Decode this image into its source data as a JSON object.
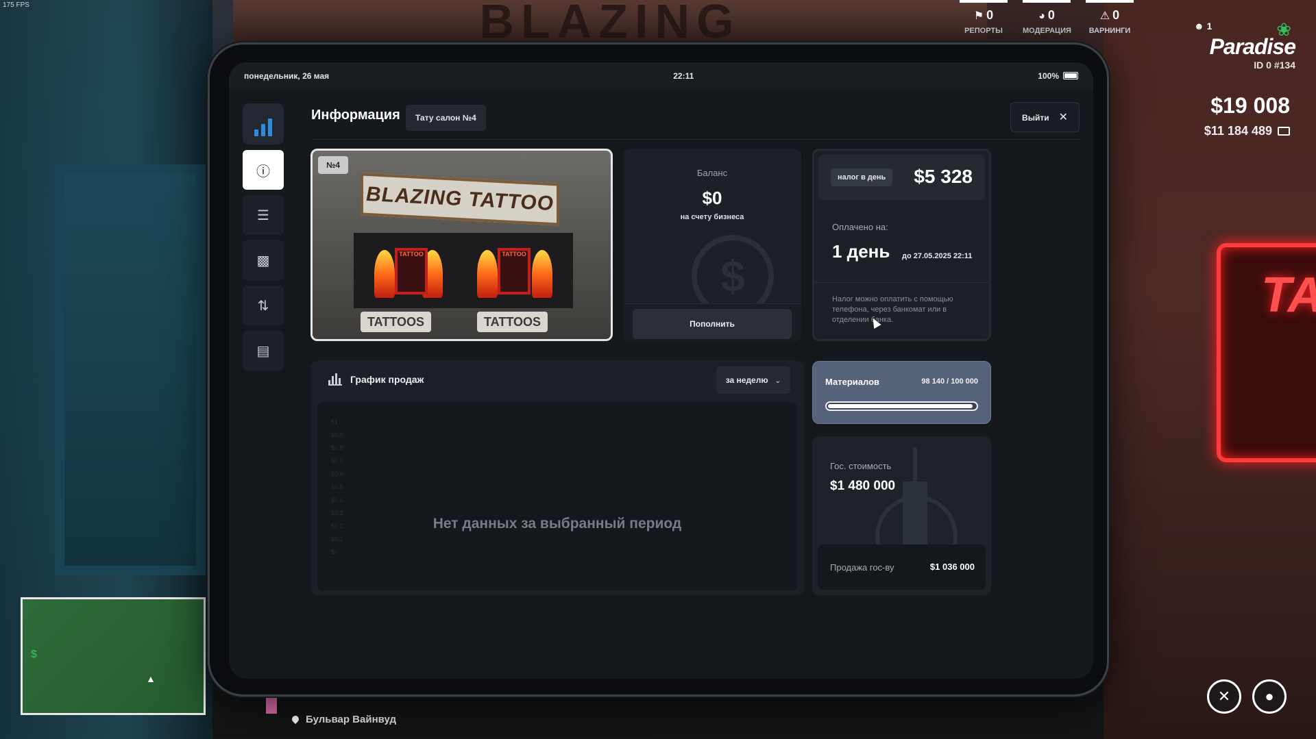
{
  "game": {
    "fps": "175 FPS",
    "world_sign": "BLAZING",
    "neon_text": "TA"
  },
  "hud": {
    "stats": [
      {
        "icon": "reports-icon",
        "value": "0",
        "label": "РЕПОРТЫ"
      },
      {
        "icon": "moderation-icon",
        "value": "0",
        "label": "МОДЕРАЦИЯ"
      },
      {
        "icon": "warning-icon",
        "value": "0",
        "label": "ВАРНИНГИ"
      }
    ],
    "logo": {
      "online": "1",
      "title": "Paradise",
      "ids": "ID 0 #134"
    },
    "cash": "$19 008",
    "bank": "$11 184 489",
    "location": "Бульвар Вайнвуд",
    "round_buttons": [
      "tools-icon",
      "drop-icon"
    ]
  },
  "tablet": {
    "status": {
      "date": "понедельник, 26 мая",
      "time": "22:11",
      "battery": "100%"
    },
    "header": {
      "title": "Информация",
      "business": "Тату салон №4",
      "exit": "Выйти"
    },
    "sidebar": [
      {
        "icon": "info-icon",
        "active": true
      },
      {
        "icon": "layers-icon",
        "active": false
      },
      {
        "icon": "bar-chart-icon",
        "active": false
      },
      {
        "icon": "money-transfer-icon",
        "active": false
      },
      {
        "icon": "clipboard-icon",
        "active": false
      }
    ],
    "photo": {
      "badge": "№4",
      "sign": "BLAZING TATTOO",
      "window_left": "TATTOO",
      "window_right": "TATTOO",
      "sign_left": "TATTOOS",
      "sign_right": "TATTOOS"
    },
    "balance": {
      "label": "Баланс",
      "value": "$0",
      "sub": "на счету бизнеса",
      "button": "Пополнить"
    },
    "tax": {
      "chip": "налог в день",
      "amount": "$5 328",
      "paid_label": "Оплачено на:",
      "paid_value": "1 день",
      "paid_until": "до 27.05.2025 22:11",
      "note": "Налог можно оплатить с помощью телефона, через банкомат или в отделении банка."
    },
    "chart": {
      "title": "График продаж",
      "period": "за неделю",
      "no_data": "Нет данных за выбранный период",
      "y_ticks": [
        "$1",
        "$0.9",
        "$0.8",
        "$0.7",
        "$0.6",
        "$0.5",
        "$0.4",
        "$0.3",
        "$0.2",
        "$0.1",
        "$0"
      ],
      "x_ticks": [
        "",
        "",
        "",
        "",
        "",
        "",
        ""
      ],
      "legend": [
        {
          "name": "",
          "color": "#1f2329"
        },
        {
          "name": "",
          "color": "#2a2f36"
        }
      ]
    },
    "materials": {
      "label": "Материалов",
      "count": "98 140 / 100 000",
      "fraction": 0.9814
    },
    "gov": {
      "label": "Гос. стоимость",
      "value": "$1 480 000",
      "sale_label": "Продажа гос-ву",
      "sale_value": "$1 036 000"
    }
  },
  "chart_data": {
    "type": "line",
    "title": "График продаж",
    "categories": [
      "",
      "",
      "",
      "",
      "",
      "",
      ""
    ],
    "series": [
      {
        "name": "",
        "values": []
      },
      {
        "name": "",
        "values": []
      }
    ],
    "ylim": [
      0,
      1
    ],
    "xlabel": "",
    "ylabel": "",
    "legend": "bottom",
    "grid": false
  }
}
